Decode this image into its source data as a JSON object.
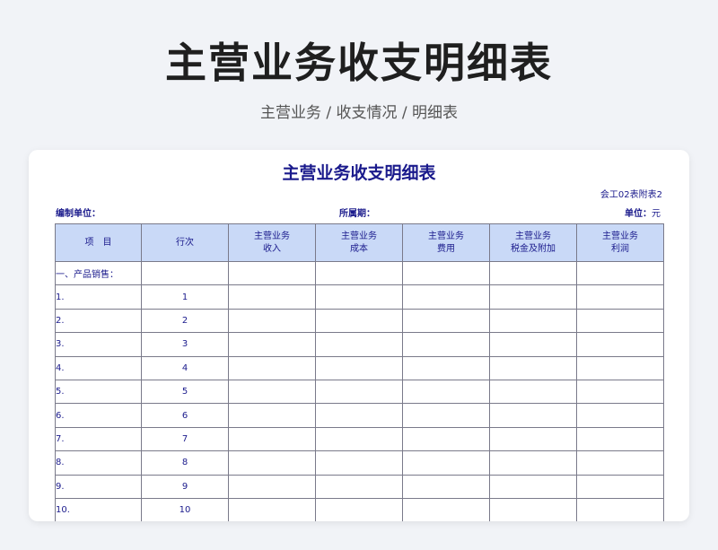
{
  "header": {
    "title": "主营业务收支明细表",
    "breadcrumb": "主营业务 / 收支情况 / 明细表"
  },
  "sheet": {
    "title": "主营业务收支明细表",
    "form_code": "会工02表附表2",
    "org_label": "编制单位：",
    "period_label": "所属期：",
    "unit_label": "单位：",
    "unit_value": "元"
  },
  "table": {
    "columns": [
      {
        "line1": "项　目",
        "line2": ""
      },
      {
        "line1": "行次",
        "line2": ""
      },
      {
        "line1": "主营业务",
        "line2": "收入"
      },
      {
        "line1": "主营业务",
        "line2": "成本"
      },
      {
        "line1": "主营业务",
        "line2": "费用"
      },
      {
        "line1": "主营业务",
        "line2": "税金及附加"
      },
      {
        "line1": "主营业务",
        "line2": "利润"
      }
    ],
    "section": "一、产品销售：",
    "rows": [
      {
        "item": "1.",
        "line": "1"
      },
      {
        "item": "2.",
        "line": "2"
      },
      {
        "item": "3.",
        "line": "3"
      },
      {
        "item": "4.",
        "line": "4"
      },
      {
        "item": "5.",
        "line": "5"
      },
      {
        "item": "6.",
        "line": "6"
      },
      {
        "item": "7.",
        "line": "7"
      },
      {
        "item": "8.",
        "line": "8"
      },
      {
        "item": "9.",
        "line": "9"
      },
      {
        "item": "10.",
        "line": "10"
      }
    ]
  },
  "colors": {
    "header_fill": "#c9d9f7",
    "text_navy": "#1a1a8c"
  }
}
